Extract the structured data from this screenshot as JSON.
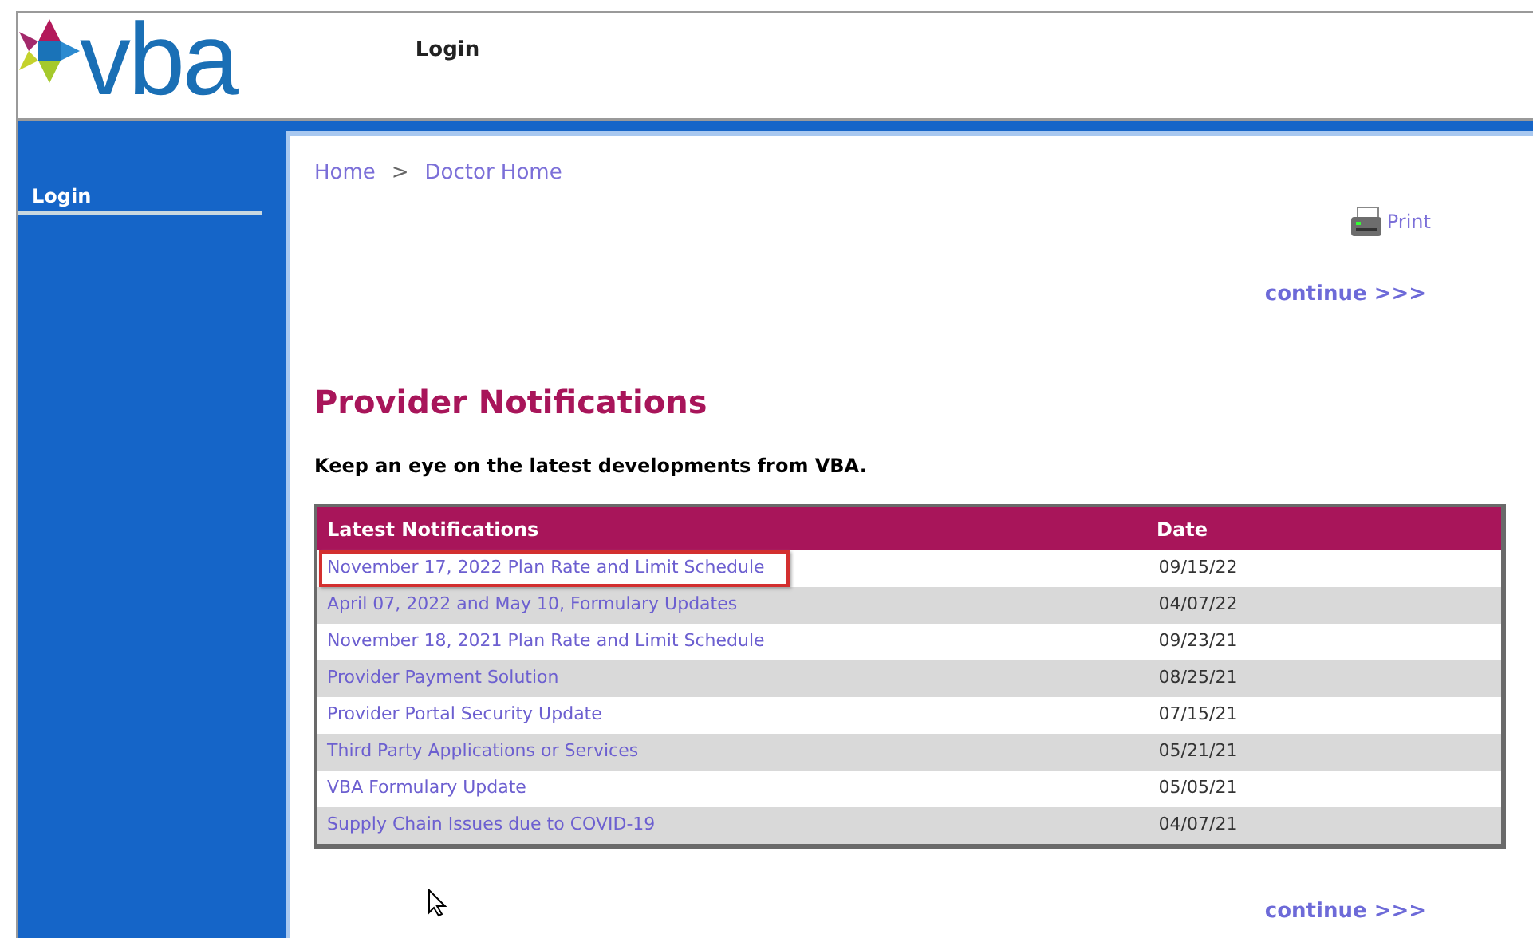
{
  "header": {
    "logo": "vba",
    "nav_title": "Login"
  },
  "sidebar": {
    "items": [
      {
        "label": "Login",
        "selected": true
      }
    ]
  },
  "breadcrumb": [
    "Home",
    "Doctor Home"
  ],
  "breadcrumb_separator": ">",
  "print_link": "Print",
  "continue_top": "continue >>>",
  "heading": "Provider Notifications",
  "subheading": "Keep an eye on the latest developments from VBA.",
  "table": {
    "columns": [
      "Latest Notifications",
      "Date"
    ],
    "rows": [
      {
        "title": "November 17, 2022 Plan Rate and Limit Schedule",
        "date": "09/15/22",
        "highlighted": true
      },
      {
        "title": "April 07, 2022 and May 10, Formulary Updates",
        "date": "04/07/22",
        "highlighted": false
      },
      {
        "title": "November 18, 2021 Plan Rate and Limit Schedule",
        "date": "09/23/21",
        "highlighted": false
      },
      {
        "title": "Provider Payment Solution",
        "date": "08/25/21",
        "highlighted": false
      },
      {
        "title": "Provider Portal Security Update",
        "date": "07/15/21",
        "highlighted": false
      },
      {
        "title": "Third Party Applications or Services",
        "date": "05/21/21",
        "highlighted": false
      },
      {
        "title": "VBA Formulary Update",
        "date": "05/05/21",
        "highlighted": false
      },
      {
        "title": "Supply Chain Issues due to COVID-19",
        "date": "04/07/21",
        "highlighted": false
      }
    ]
  },
  "continue_bottom": "continue >>>"
}
